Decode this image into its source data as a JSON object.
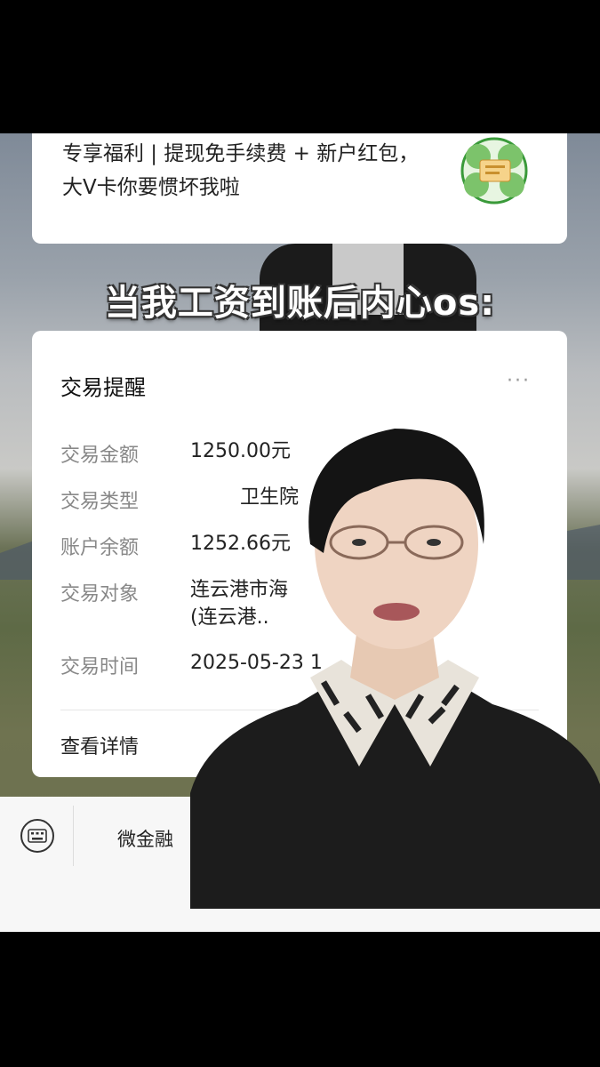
{
  "promo": {
    "text": "专享福利 | 提现免手续费 + 新户红包，大V卡你要惯坏我啦"
  },
  "overlay": {
    "title": "当我工资到账后内心os:"
  },
  "transaction": {
    "title": "交易提醒",
    "more": "···",
    "rows": [
      {
        "label": "交易金额",
        "value": "1250.00元"
      },
      {
        "label": "交易类型",
        "value": "        卫生院"
      },
      {
        "label": "账户余额",
        "value": "1252.66元"
      },
      {
        "label": "交易对象",
        "value": "连云港市海                  员会\n(连云港.."
      },
      {
        "label": "交易时间",
        "value": "2025-05-23 1"
      }
    ],
    "detail_link": "查看详情"
  },
  "bottom_bar": {
    "label": "微金融",
    "keyboard_icon": "keyboard-icon"
  },
  "colors": {
    "card_bg": "#ffffff",
    "label_gray": "#888888",
    "text_dark": "#222222"
  }
}
